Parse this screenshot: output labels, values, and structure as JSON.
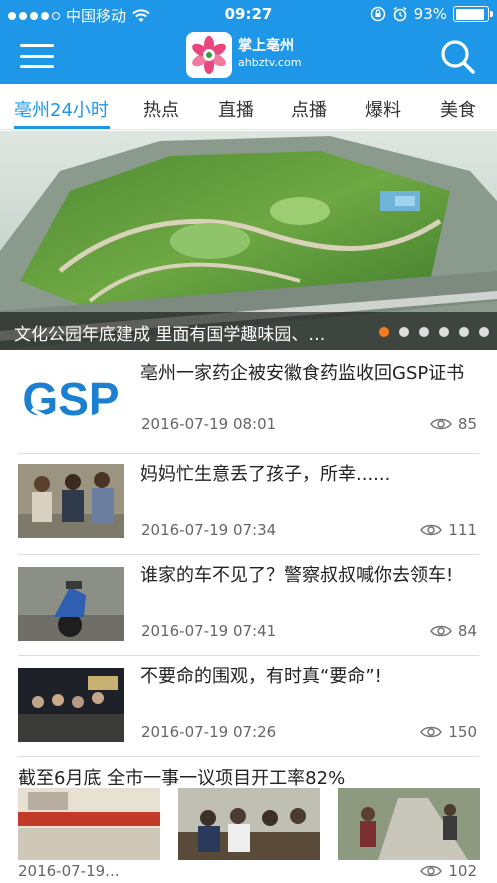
{
  "status_bar": {
    "carrier": "中国移动",
    "time": "09:27",
    "battery": "93%",
    "battery_level": 0.93
  },
  "header": {
    "app_name": "掌上亳州",
    "domain": "ahbztv.com"
  },
  "tabs": [
    {
      "label": "亳州24小时",
      "active": true
    },
    {
      "label": "热点"
    },
    {
      "label": "直播"
    },
    {
      "label": "点播"
    },
    {
      "label": "爆料"
    },
    {
      "label": "美食"
    }
  ],
  "banner": {
    "caption": "文化公园年底建成  里面有国学趣味园、…",
    "slide_count": 6,
    "active_slide": 1
  },
  "news": [
    {
      "title": "亳州一家药企被安徽食药监收回GSP证书",
      "date": "2016-07-19 08:01",
      "views": "85",
      "thumb": "gsp-logo"
    },
    {
      "title": "妈妈忙生意丢了孩子，所幸......",
      "date": "2016-07-19 07:34",
      "views": "111",
      "thumb": "crowd-photo"
    },
    {
      "title": "谁家的车不见了？警察叔叔喊你去领车!",
      "date": "2016-07-19 07:41",
      "views": "84",
      "thumb": "scooter-photo"
    },
    {
      "title": "不要命的围观，有时真“要命”!",
      "date": "2016-07-19 07:26",
      "views": "150",
      "thumb": "night-street-photo"
    }
  ],
  "group_item": {
    "title": "截至6月底 全市一事一议项目开工率82%",
    "date": "2016-07-19...",
    "views": "102"
  },
  "colors": {
    "primary": "#1e97e8",
    "pager_active": "#f47a20"
  }
}
